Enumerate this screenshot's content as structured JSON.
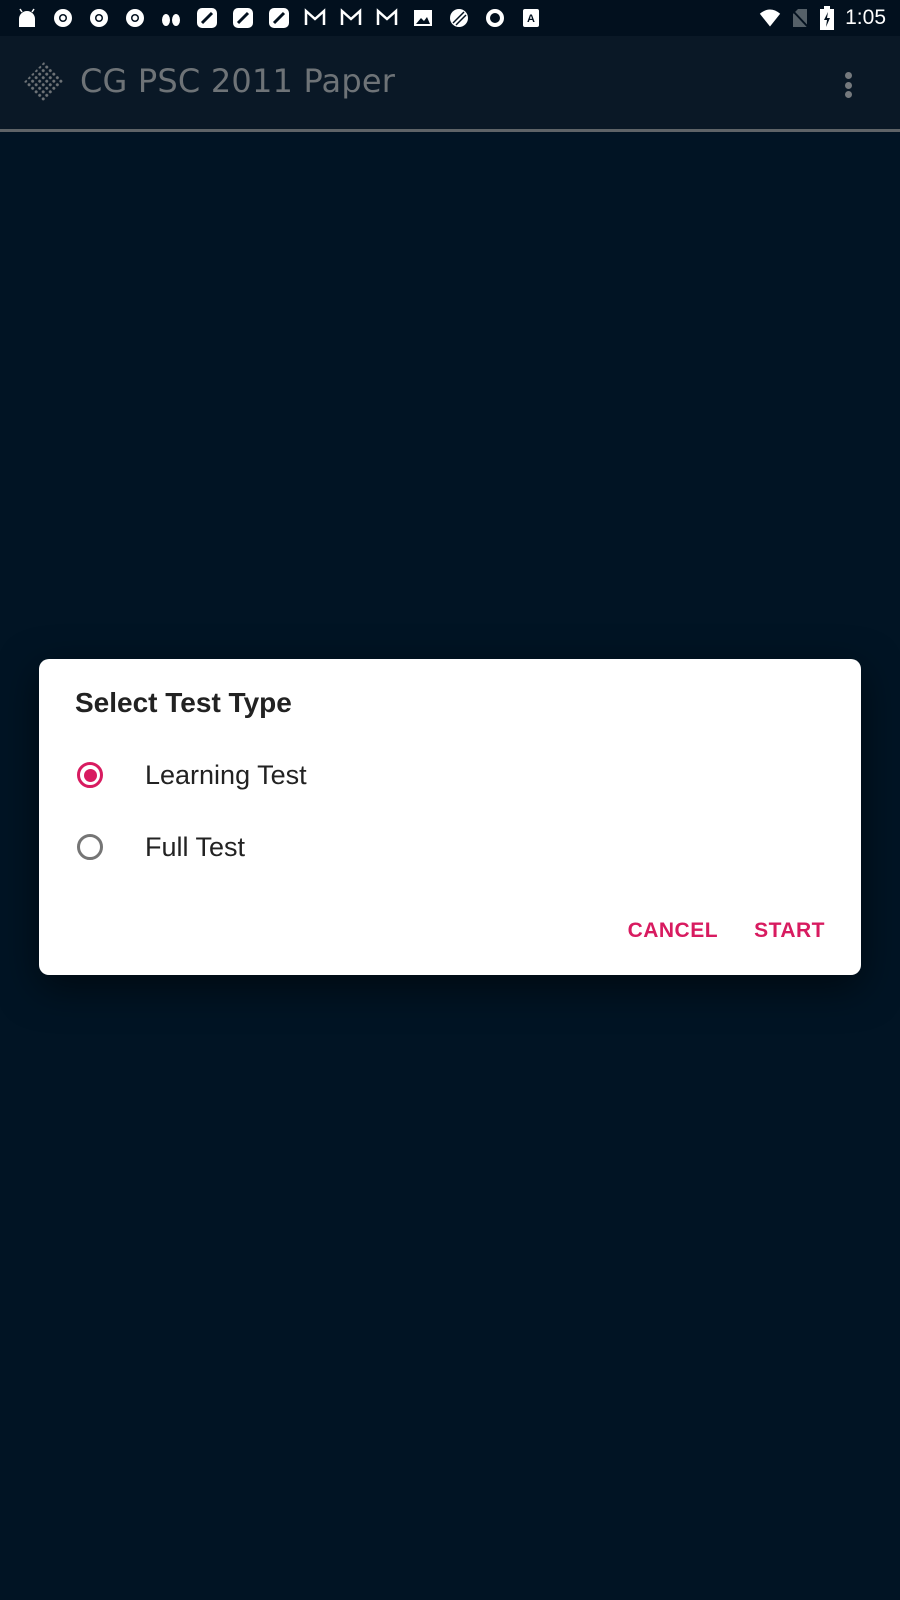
{
  "status_bar": {
    "notification_icons": [
      "android-icon",
      "chrome-icon",
      "chrome-icon",
      "chrome-icon",
      "butterfly-icon",
      "quickedit-icon",
      "quickedit-icon",
      "quickedit-icon",
      "gmail-icon",
      "gmail-icon",
      "gmail-icon",
      "image-icon",
      "striped-ball-icon",
      "ring-app-icon",
      "font-app-icon"
    ],
    "time": "1:05",
    "wifi_icon": "wifi-icon",
    "signal_icon": "no-sim-icon",
    "battery_icon": "battery-charging-icon"
  },
  "app_bar": {
    "title": "CG PSC 2011 Paper",
    "logo_icon": "diamond-grid-logo",
    "overflow_icon": "more-vert-icon"
  },
  "dialog": {
    "title": "Select Test Type",
    "options": [
      {
        "label": "Learning Test",
        "selected": true
      },
      {
        "label": "Full Test",
        "selected": false
      }
    ],
    "cancel_label": "CANCEL",
    "start_label": "START",
    "accent_color": "#d81b60"
  },
  "colors": {
    "background": "#011424",
    "app_bar": "#0a1826",
    "title_text": "#6e7377",
    "dialog_bg": "#ffffff",
    "accent": "#d81b60"
  }
}
